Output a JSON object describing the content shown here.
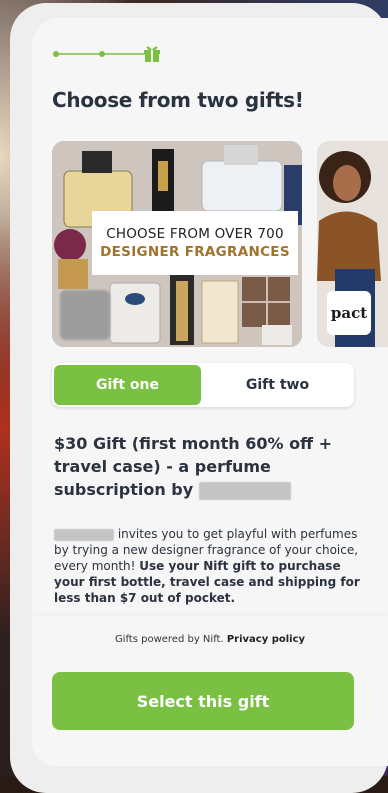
{
  "progress": {
    "steps": 3,
    "current_step": 2,
    "gift_icon": "gift-icon"
  },
  "title": "Choose from two gifts!",
  "carousel": {
    "slide1": {
      "line1": "CHOOSE FROM OVER 700",
      "line2": "DESIGNER FRAGRANCES"
    },
    "slide2": {
      "logo_text": "pact"
    }
  },
  "tabs": [
    {
      "label": "Gift one",
      "active": true
    },
    {
      "label": "Gift two",
      "active": false
    }
  ],
  "gift": {
    "title": "$30 Gift (first month 60% off + travel case) - a perfume subscription by"
  },
  "description": {
    "text": " invites you to get playful with perfumes by trying a new designer fragrance of your choice, every month! ",
    "bold": "Use your Nift gift to purchase your first bottle, travel case and shipping for less than $7 out of pocket."
  },
  "footer": {
    "powered_by": "Gifts powered by Nift.",
    "privacy_link": "Privacy policy",
    "cta_label": "Select this gift"
  },
  "colors": {
    "accent": "#7ac143",
    "text": "#2b3340",
    "promo_gold": "#a0732c"
  }
}
